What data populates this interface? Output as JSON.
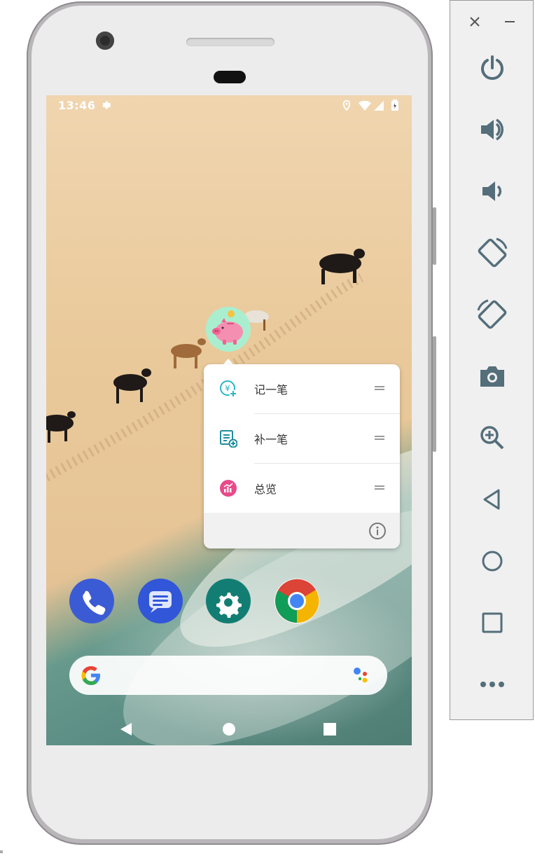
{
  "status_bar": {
    "time": "13:46"
  },
  "shortcut_menu": {
    "items": [
      {
        "label": "记一笔",
        "icon": "yen-add-icon",
        "color": "#29b6c6"
      },
      {
        "label": "补一笔",
        "icon": "ledger-add-icon",
        "color": "#1e8e9e"
      },
      {
        "label": "总览",
        "icon": "chart-icon",
        "color": "#e84a8a"
      }
    ],
    "footer_icon": "info-icon"
  },
  "home_screen": {
    "app_icon": "piggy-bank-icon",
    "dock": [
      "phone-app-icon",
      "messages-app-icon",
      "settings-app-icon",
      "chrome-app-icon"
    ],
    "search_bar": {
      "left_icon": "google-logo-icon",
      "right_icon": "assistant-icon"
    }
  },
  "toolbar": {
    "buttons": [
      "close-icon",
      "minimize-icon",
      "power-icon",
      "volume-up-icon",
      "volume-down-icon",
      "rotate-left-icon",
      "rotate-right-icon",
      "screenshot-icon",
      "zoom-icon",
      "back-icon",
      "home-icon",
      "overview-icon",
      "more-icon"
    ]
  },
  "colors": {
    "toolbar_icon": "#546e7a",
    "icon_teal": "#29b6c6",
    "app_icon_bg": "#a9efcf",
    "piggy_pink": "#f48fb1"
  }
}
